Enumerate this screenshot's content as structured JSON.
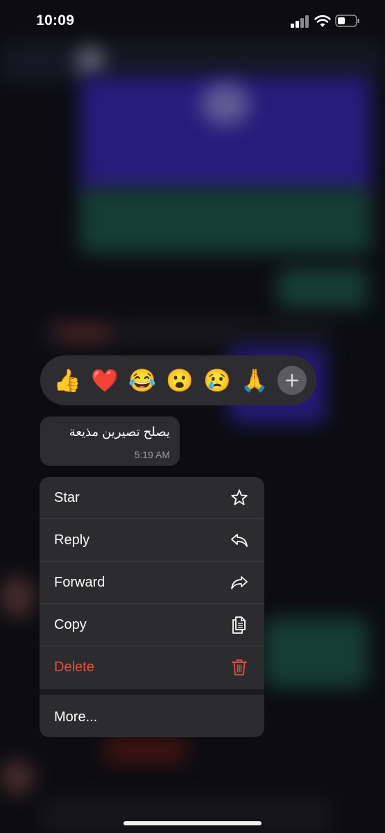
{
  "status_bar": {
    "time": "10:09"
  },
  "reactions": [
    {
      "emoji": "👍",
      "name": "thumbs-up-reaction"
    },
    {
      "emoji": "❤️",
      "name": "heart-reaction"
    },
    {
      "emoji": "😂",
      "name": "laughing-reaction"
    },
    {
      "emoji": "😮",
      "name": "surprised-reaction"
    },
    {
      "emoji": "😢",
      "name": "crying-reaction"
    },
    {
      "emoji": "🙏",
      "name": "praying-hands-reaction"
    }
  ],
  "message": {
    "text": "يصلح تصيرين مذيعة",
    "time": "5:19 AM"
  },
  "menu": {
    "star": "Star",
    "reply": "Reply",
    "forward": "Forward",
    "copy": "Copy",
    "delete": "Delete",
    "more": "More..."
  },
  "colors": {
    "destructive": "#eb4d3d",
    "menu_bg": "#2c2c2e",
    "bubble_bg": "#2d2d31"
  }
}
